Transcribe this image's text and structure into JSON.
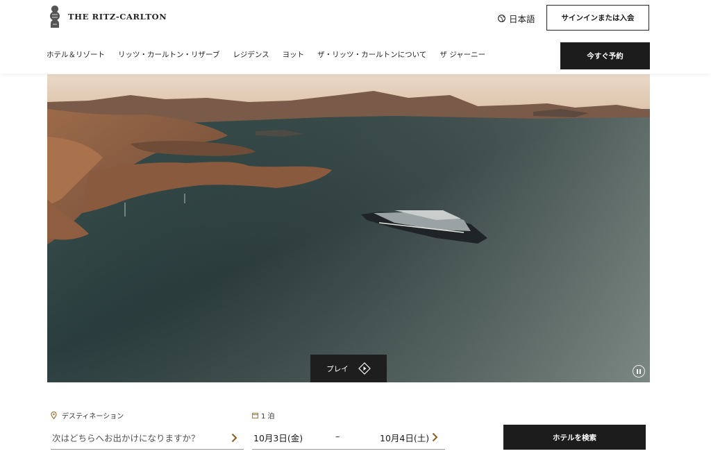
{
  "header": {
    "brand": "THE RITZ-CARLTON",
    "language": "日本語",
    "signin_label": "サインインまたは入会",
    "book_label": "今すぐ予約",
    "nav": [
      "ホテル＆リゾート",
      "リッツ・カールトン・リザーブ",
      "レジデンス",
      "ヨット",
      "ザ・リッツ・カールトンについて",
      "ザ ジャーニー"
    ]
  },
  "hero": {
    "play_label": "プレイ",
    "icons": [
      "play-diamond-icon",
      "pause-icon"
    ]
  },
  "booking": {
    "destination_label": "デスティネーション",
    "destination_placeholder": "次はどちらへお出かけになりますか？",
    "nights_label": "1 泊",
    "checkin": "10月3日(金)",
    "separator": "–",
    "checkout": "10月4日(土)",
    "search_label": "ホテルを検索"
  },
  "colors": {
    "button_dark": "#1c1c1c",
    "accent_gold": "#9a6b2f"
  }
}
